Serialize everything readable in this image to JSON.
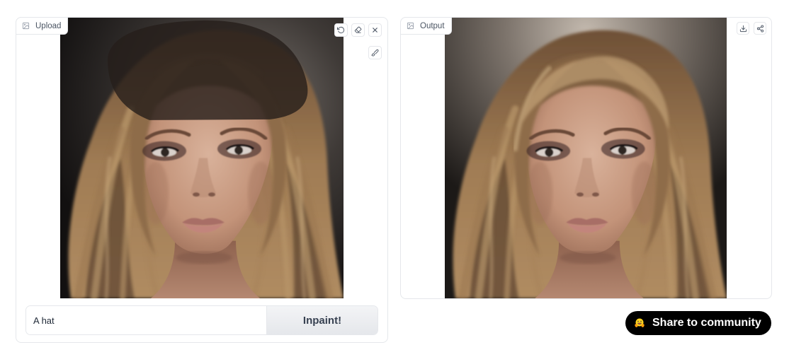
{
  "upload_panel": {
    "label": "Upload",
    "label_icon": "image-icon",
    "toolbar": {
      "undo_icon": "undo-icon",
      "eraser_icon": "eraser-icon",
      "clear_icon": "close-icon",
      "brush_icon": "brush-icon"
    }
  },
  "prompt": {
    "value": "A hat",
    "button_label": "Inpaint!"
  },
  "output_panel": {
    "label": "Output",
    "label_icon": "image-icon",
    "toolbar": {
      "download_icon": "download-icon",
      "share_icon": "share-icon"
    }
  },
  "share": {
    "label": "Share to community",
    "icon": "hugging-face-icon"
  },
  "colors": {
    "panel_border": "#e5e7eb",
    "label_text": "#4b5563",
    "button_bg_top": "#f3f4f6",
    "button_bg_bottom": "#e5e7eb",
    "button_text": "#374151",
    "share_button_bg": "#000000",
    "share_button_text": "#ffffff",
    "mask_fill": "#261e1a"
  }
}
